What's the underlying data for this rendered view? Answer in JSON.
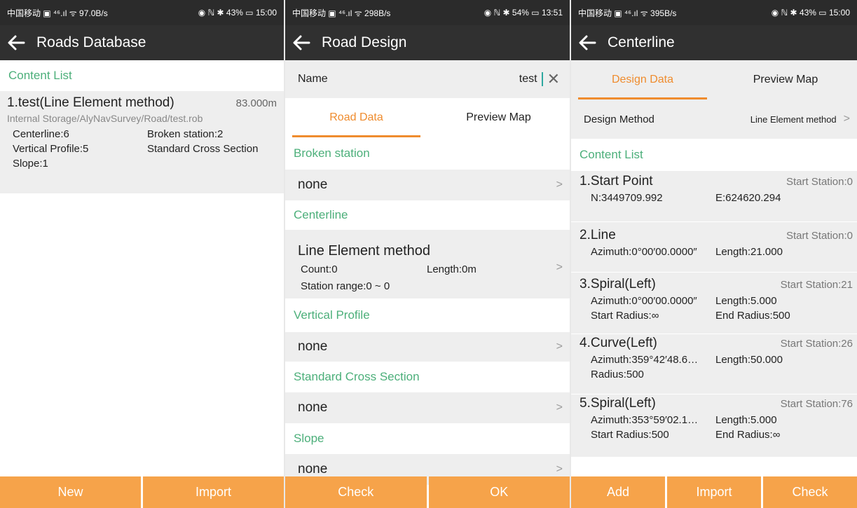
{
  "screen1": {
    "status": {
      "left": "中国移动 ▣ ⁴⁶.ıl ᯤ 97.0B/s",
      "right": "◉ ℕ ✱ 43% ▭ 15:00"
    },
    "title": "Roads Database",
    "content_list_label": "Content List",
    "item": {
      "name": "1.test(Line Element method)",
      "length": "83.000m",
      "path": "Internal Storage/AlyNavSurvey/Road/test.rob",
      "centerline": "Centerline:6",
      "broken_station": "Broken station:2",
      "vertical_profile": "Vertical Profile:5",
      "standard_cross_section": "Standard Cross Section",
      "slope": "Slope:1"
    },
    "buttons": {
      "new": "New",
      "import": "Import"
    }
  },
  "screen2": {
    "status": {
      "left": "中国移动 ▣ ⁴⁶.ıl ᯤ 298B/s",
      "right": "◉ ℕ ✱ 54% ▭ 13:51"
    },
    "title": "Road Design",
    "name_label": "Name",
    "name_value": "test",
    "tabs": {
      "road_data": "Road Data",
      "preview_map": "Preview Map"
    },
    "broken_station": {
      "label": "Broken station",
      "value": "none"
    },
    "centerline": {
      "label": "Centerline",
      "method": "Line Element method",
      "count": "Count:0",
      "length": "Length:0m",
      "station_range": "Station range:0 ~ 0"
    },
    "vertical_profile": {
      "label": "Vertical Profile",
      "value": "none"
    },
    "standard_cross_section": {
      "label": "Standard Cross Section",
      "value": "none"
    },
    "slope": {
      "label": "Slope",
      "value": "none"
    },
    "buttons": {
      "check": "Check",
      "ok": "OK"
    }
  },
  "screen3": {
    "status": {
      "left": "中国移动 ▣ ⁴⁶.ıl ᯤ 395B/s",
      "right": "◉ ℕ ✱ 43% ▭ 15:00"
    },
    "title": "Centerline",
    "tabs": {
      "design_data": "Design Data",
      "preview_map": "Preview Map"
    },
    "design_method_label": "Design Method",
    "design_method_value": "Line Element method",
    "content_list_label": "Content List",
    "items": [
      {
        "title": "1.Start Point",
        "station": "Start Station:0",
        "a": "N:3449709.992",
        "b": "E:624620.294"
      },
      {
        "title": "2.Line",
        "station": "Start Station:0",
        "a": "Azimuth:0°00′00.0000″",
        "b": "Length:21.000"
      },
      {
        "title": "3.Spiral(Left)",
        "station": "Start Station:21",
        "a": "Azimuth:0°00′00.0000″",
        "b": "Length:5.000",
        "c": "Start Radius:∞",
        "d": "End Radius:500"
      },
      {
        "title": "4.Curve(Left)",
        "station": "Start Station:26",
        "a": "Azimuth:359°42′48.6…",
        "b": "Length:50.000",
        "c": "Radius:500"
      },
      {
        "title": "5.Spiral(Left)",
        "station": "Start Station:76",
        "a": "Azimuth:353°59′02.1…",
        "b": "Length:5.000",
        "c": "Start Radius:500",
        "d": "End Radius:∞"
      }
    ],
    "buttons": {
      "add": "Add",
      "import": "Import",
      "check": "Check"
    }
  }
}
